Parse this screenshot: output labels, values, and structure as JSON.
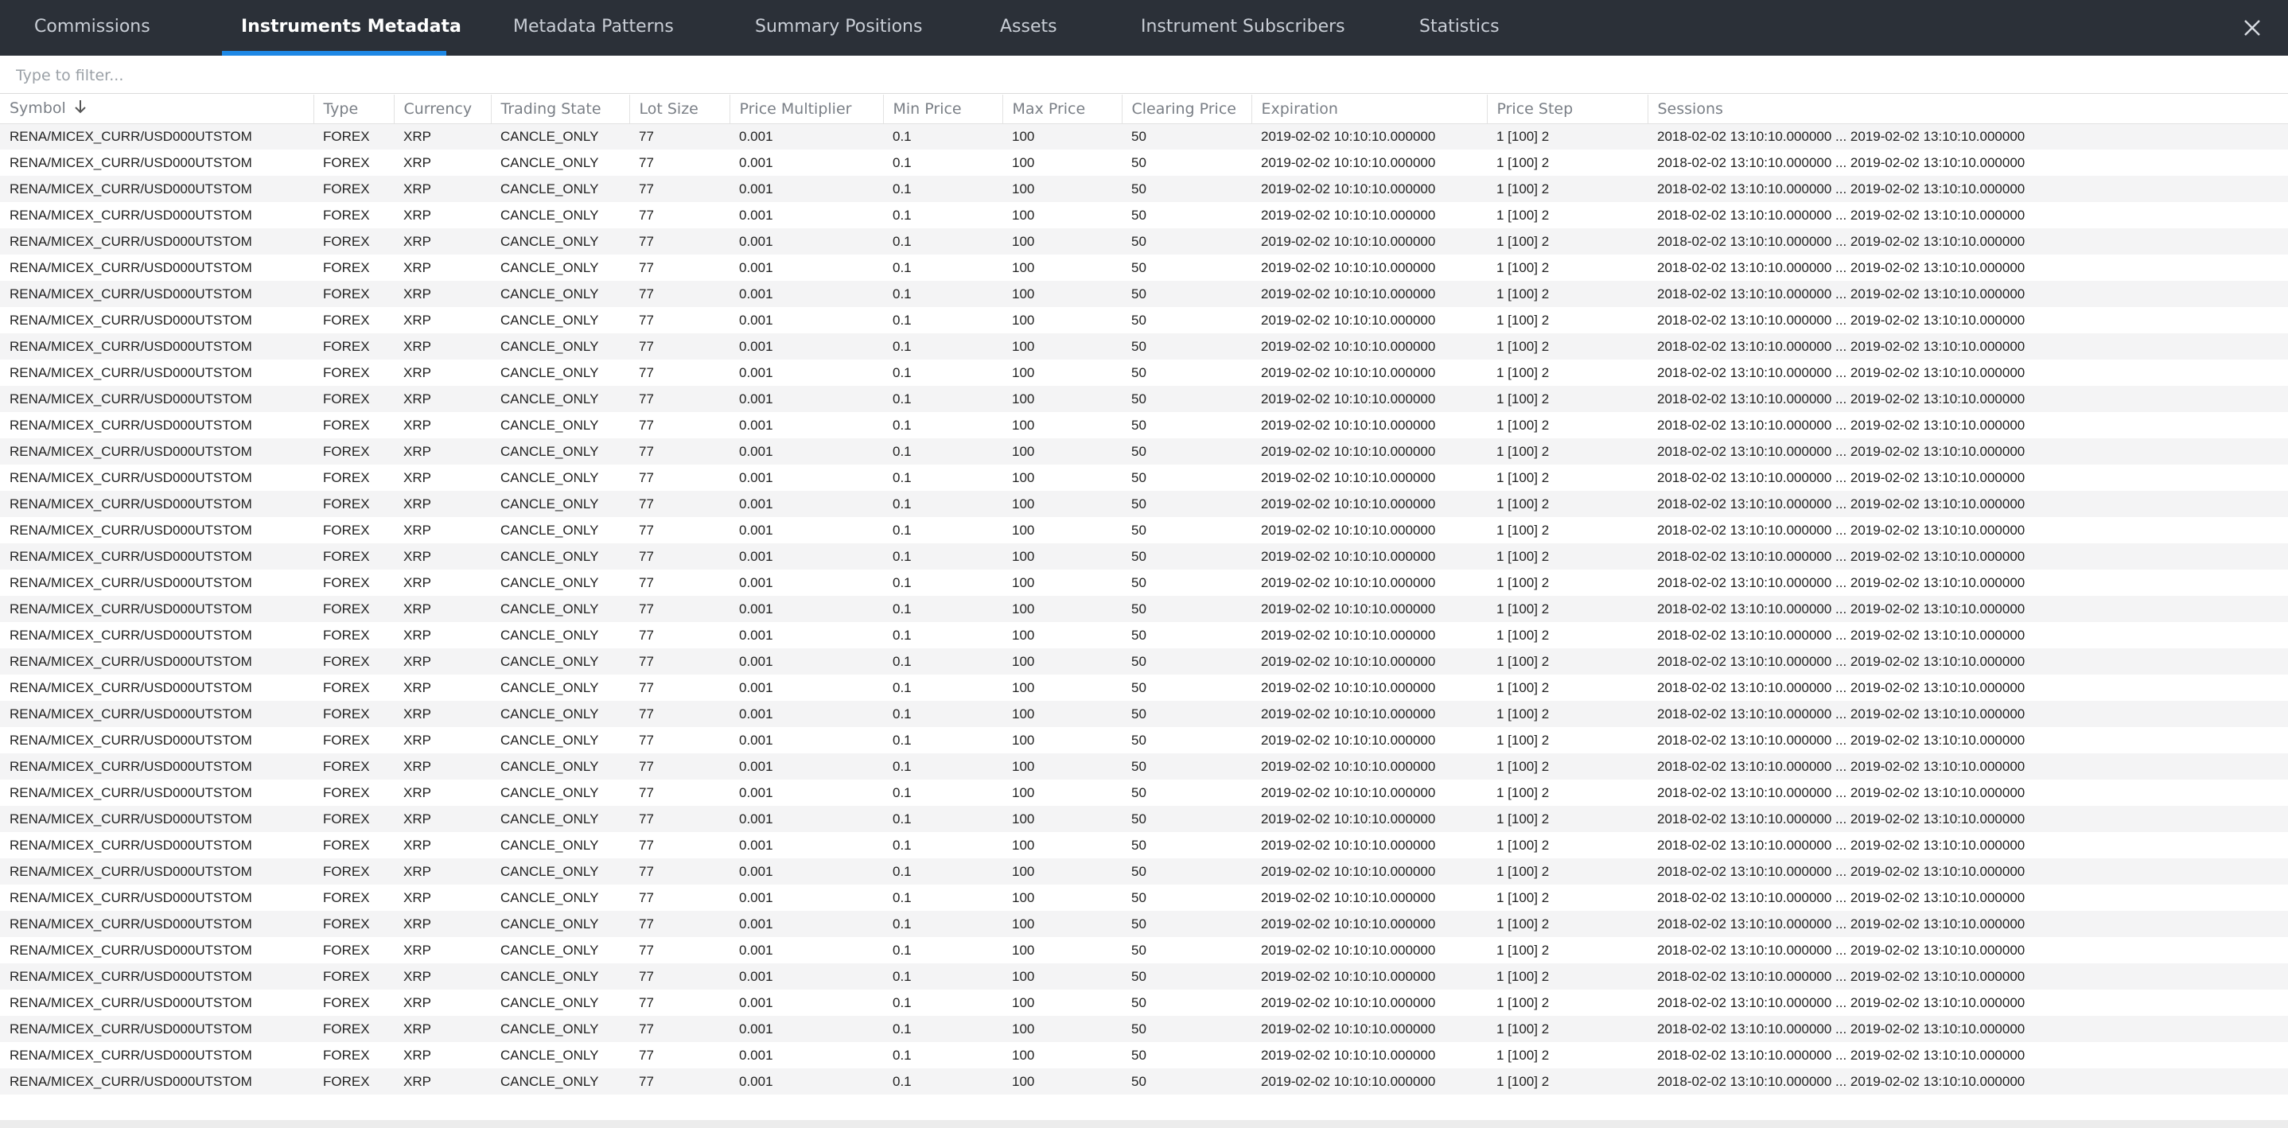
{
  "tabs": [
    {
      "label": "Commissions"
    },
    {
      "label": "Instruments Metadata"
    },
    {
      "label": "Metadata Patterns"
    },
    {
      "label": "Summary Positions"
    },
    {
      "label": "Assets"
    },
    {
      "label": "Instrument Subscribers"
    },
    {
      "label": "Statistics"
    }
  ],
  "active_tab": "Instruments Metadata",
  "filter": {
    "placeholder": "Type to filter...",
    "value": ""
  },
  "table": {
    "sort": {
      "column": "Symbol",
      "direction": "descending"
    },
    "columns": [
      "Symbol",
      "Type",
      "Currency",
      "Trading State",
      "Lot Size",
      "Price Multiplier",
      "Min Price",
      "Max Price",
      "Clearing Price",
      "Expiration",
      "Price Step",
      "Sessions"
    ],
    "row": [
      "RENA/MICEX_CURR/USD000UTSTOM",
      "FOREX",
      "XRP",
      "CANCLE_ONLY",
      "77",
      "0.001",
      "0.1",
      "100",
      "50",
      "2019-02-02 10:10:10.000000",
      "1 [100] 2",
      "2018-02-02 13:10:10.000000 ... 2019-02-02 13:10:10.000000"
    ],
    "row_count": 37
  },
  "colors": {
    "topbar": "#2b3038",
    "accent": "#1e88e5",
    "row_stripe": "#f4f4f5"
  }
}
